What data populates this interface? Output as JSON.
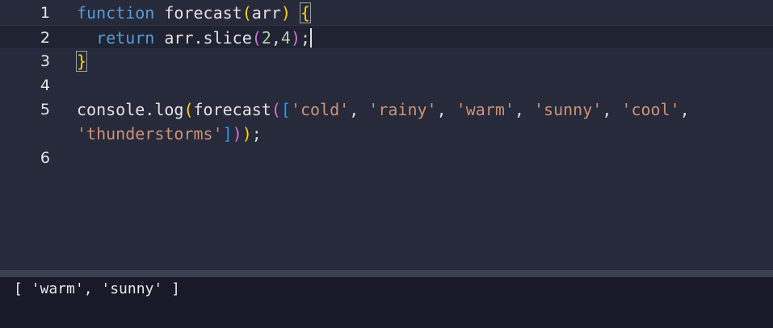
{
  "editor": {
    "line_numbers": [
      "1",
      "2",
      "3",
      "4",
      "5",
      "6"
    ],
    "line1": {
      "kw": "function",
      "name": "forecast",
      "open_paren": "(",
      "param": "arr",
      "close_paren": ")",
      "space": " ",
      "brace": "{"
    },
    "line2": {
      "indent": "  ",
      "kw": "return",
      "code": " arr.slice",
      "open": "(",
      "n1": "2",
      "comma": ",",
      "n2": "4",
      "close": ")",
      "semi": ";"
    },
    "line3": {
      "brace": "}"
    },
    "line5": {
      "console": "console",
      "dot": ".",
      "log": "log",
      "p1": "(",
      "fn": "forecast",
      "p2": "(",
      "b": "[",
      "s1": "'cold'",
      "c1": ", ",
      "s2": "'rainy'",
      "c2": ", ",
      "s3": "'warm'",
      "c3": ", ",
      "s4": "'sunny'",
      "c4": ", ",
      "s5": "'cool'",
      "c5": ","
    },
    "line5_wrap": {
      "s6": "'thunderstorms'",
      "b": "]",
      "p2": ")",
      "p1": ")",
      "semi": ";"
    }
  },
  "console": {
    "output": "[ 'warm', 'sunny' ]"
  },
  "colors": {
    "editor_bg": "#262a3a",
    "console_bg": "#181a28",
    "keyword": "#569cd6",
    "string": "#ce9178",
    "number": "#b5cea8",
    "bracket_level1": "#ffd700",
    "bracket_level2": "#da70d6",
    "bracket_level3": "#179fff"
  }
}
